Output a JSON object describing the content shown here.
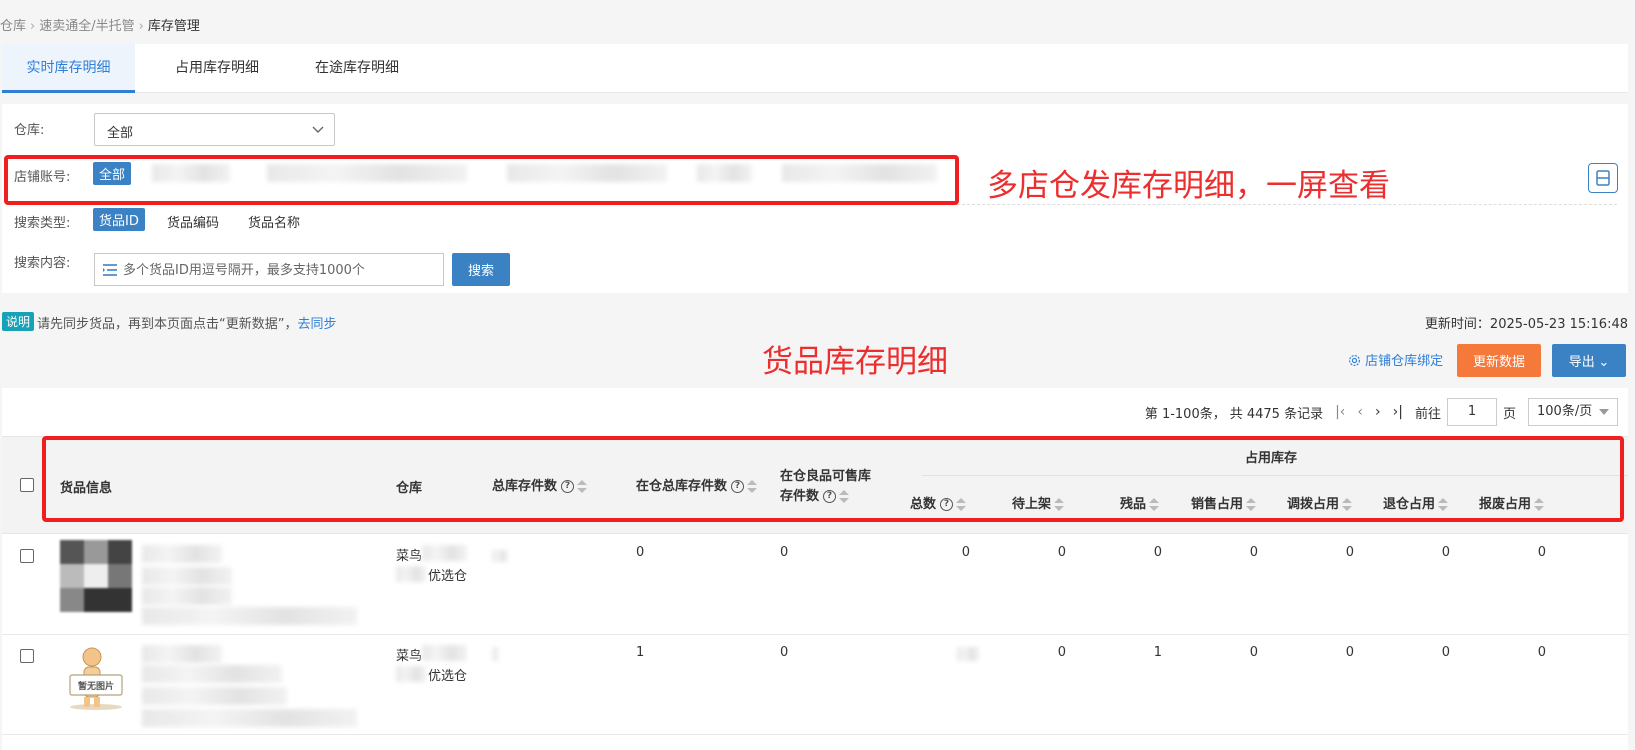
{
  "breadcrumb": [
    "仓库",
    "速卖通全/半托管",
    "库存管理"
  ],
  "tabs": [
    "实时库存明细",
    "占用库存明细",
    "在途库存明细"
  ],
  "filter": {
    "warehouse_label": "仓库:",
    "warehouse_value": "全部",
    "shop_label": "店铺账号:",
    "shop_all": "全部",
    "search_type_label": "搜索类型:",
    "search_types": [
      "货品ID",
      "货品编码",
      "货品名称"
    ],
    "search_content_label": "搜索内容:",
    "search_placeholder": "多个货品ID用逗号隔开，最多支持1000个",
    "search_button": "搜索"
  },
  "annotations": {
    "shops": "多店仓发库存明细，一屏查看",
    "goods": "货品库存明细"
  },
  "notice": {
    "tag": "说明",
    "text": "请先同步货品，再到本页面点击“更新数据”，",
    "link": "去同步",
    "update_time": "更新时间：2025-05-23 15:16:48"
  },
  "actions": {
    "bind": "店铺仓库绑定",
    "update": "更新数据",
    "export": "导出"
  },
  "pager": {
    "range": "第 1-100条，",
    "total": "共 4475 条记录",
    "goto_label": "前往",
    "page": "1",
    "page_unit": "页",
    "page_size": "100条/页"
  },
  "table": {
    "headers": {
      "goods": "货品信息",
      "warehouse": "仓库",
      "total": "总库存件数",
      "in_wh_total": "在仓总库存件数",
      "sellable_1": "在仓良品可售库",
      "sellable_2": "存件数",
      "occupied_group": "占用库存",
      "occ_total": "总数",
      "pending": "待上架",
      "defect": "残品",
      "sales": "销售占用",
      "transfer": "调拨占用",
      "return": "退仓占用",
      "scrap": "报废占用"
    },
    "rows": [
      {
        "warehouse_line1": "菜鸟",
        "warehouse_line2": "优选仓",
        "total": "",
        "in_wh_total": "0",
        "sellable": "0",
        "occ_total": "0",
        "pending": "0",
        "defect": "0",
        "sales": "0",
        "transfer": "0",
        "return": "0",
        "scrap": "0"
      },
      {
        "warehouse_line1": "菜鸟",
        "warehouse_line2": "优选仓",
        "total": "",
        "in_wh_total": "1",
        "sellable": "0",
        "occ_total": "",
        "pending": "0",
        "defect": "1",
        "sales": "0",
        "transfer": "0",
        "return": "0",
        "scrap": "0",
        "no_image_text": "暂无图片"
      }
    ]
  }
}
